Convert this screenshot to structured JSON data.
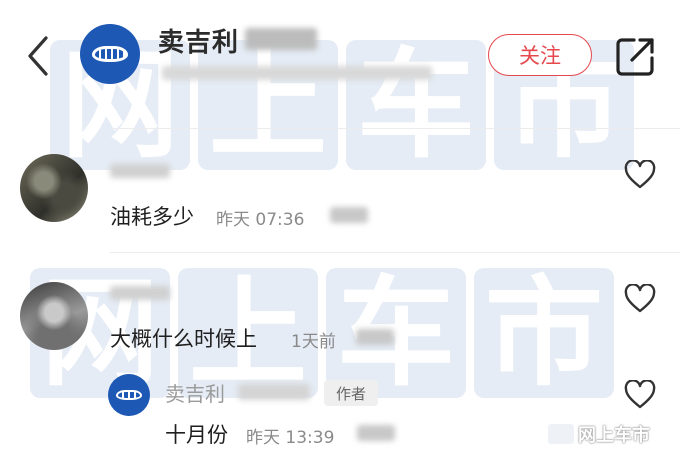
{
  "header": {
    "author_name": "卖吉利",
    "follow_label": "关注"
  },
  "comments": [
    {
      "text": "油耗多少",
      "time": "昨天 07:36"
    },
    {
      "text": "大概什么时候上",
      "time": "1天前"
    }
  ],
  "reply": {
    "author_name": "卖吉利",
    "author_tag": "作者",
    "text": "十月份",
    "time": "昨天 13:39"
  },
  "watermark": {
    "chars": [
      "网",
      "上",
      "车",
      "市"
    ],
    "small_text": "网上车市"
  },
  "colors": {
    "accent_red": "#e5484d",
    "brand_blue": "#1d58b4",
    "watermark_blue": "#3f77b7",
    "meta_gray": "#8a8a8a"
  },
  "icons": [
    "back-icon",
    "share-icon",
    "heart-icon",
    "brand-logo-icon"
  ]
}
